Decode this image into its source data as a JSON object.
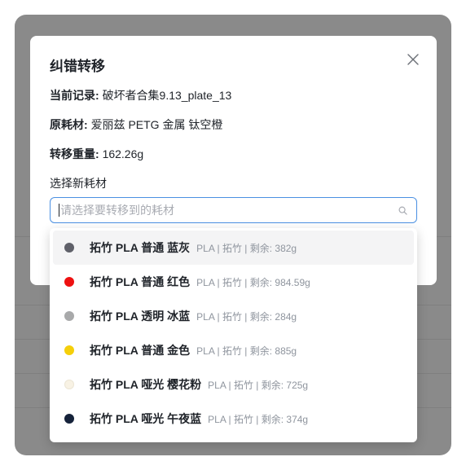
{
  "dialog": {
    "title": "纠错转移",
    "current_record_label": "当前记录:",
    "current_record_value": "破坏者合集9.13_plate_13",
    "original_material_label": "原耗材:",
    "original_material_value": "爱丽兹 PETG 金属 钛空橙",
    "transfer_weight_label": "转移重量:",
    "transfer_weight_value": "162.26g",
    "select_label": "选择新耗材",
    "select_placeholder": "请选择要转移到的耗材",
    "close_icon": "close-icon",
    "search_icon": "search-icon"
  },
  "background": {
    "partial_text": "·· ··"
  },
  "dropdown": {
    "options": [
      {
        "name": "拓竹 PLA 普通 蓝灰",
        "meta": "PLA | 拓竹 | 剩余: 382g",
        "color": "#5f6069",
        "active": true
      },
      {
        "name": "拓竹 PLA 普通 红色",
        "meta": "PLA | 拓竹 | 剩余: 984.59g",
        "color": "#ee1111"
      },
      {
        "name": "拓竹 PLA 透明 冰蓝",
        "meta": "PLA | 拓竹 | 剩余: 284g",
        "color": "#a8a9aa"
      },
      {
        "name": "拓竹 PLA 普通 金色",
        "meta": "PLA | 拓竹 | 剩余: 885g",
        "color": "#f5cf0a"
      },
      {
        "name": "拓竹 PLA 哑光 樱花粉",
        "meta": "PLA | 拓竹 | 剩余: 725g",
        "color": "#f8f2e4"
      },
      {
        "name": "拓竹 PLA 哑光 午夜蓝",
        "meta": "PLA | 拓竹 | 剩余: 374g",
        "color": "#15223a"
      }
    ]
  }
}
